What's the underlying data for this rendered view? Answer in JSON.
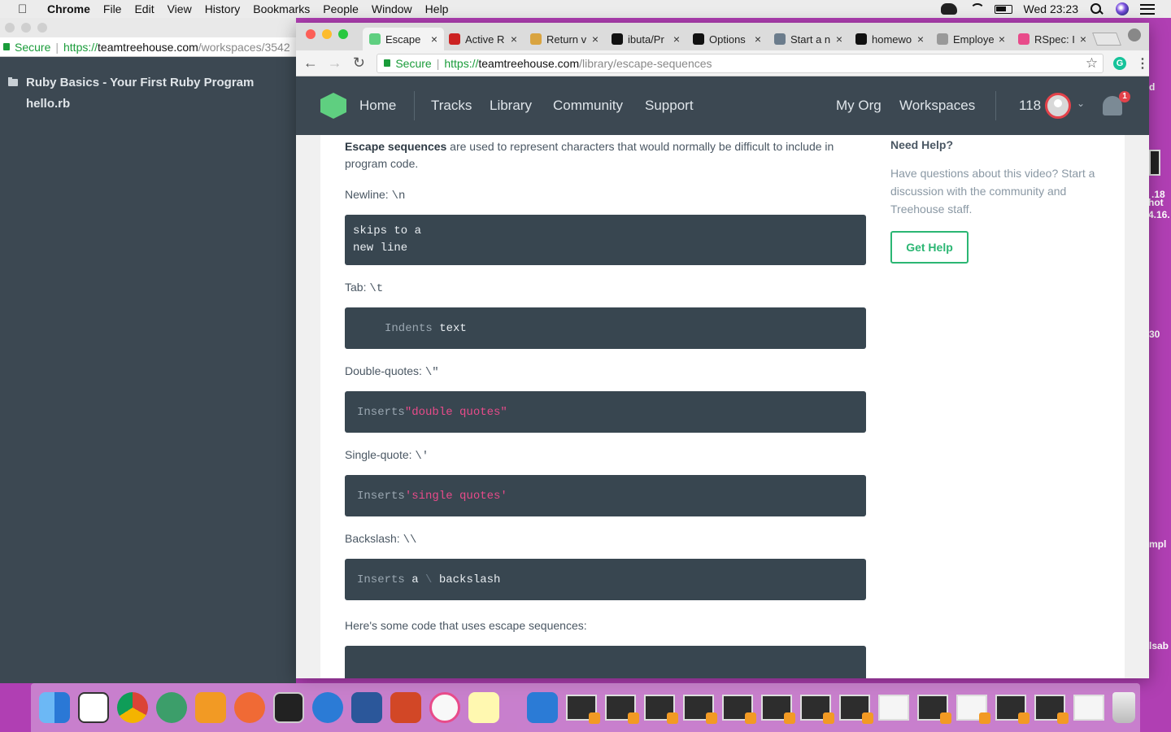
{
  "menubar": {
    "app": "Chrome",
    "items": [
      "File",
      "Edit",
      "View",
      "History",
      "Bookmarks",
      "People",
      "Window",
      "Help"
    ],
    "clock": "Wed 23:23"
  },
  "bg_window": {
    "secure": "Secure",
    "url_proto": "https://",
    "url_host": "teamtreehouse.com",
    "url_path": "/workspaces/3542",
    "folder": "Ruby Basics - Your First Ruby Program",
    "file": "hello.rb"
  },
  "desktop_fragments": [
    "d",
    ".18",
    "hot",
    "4.16.",
    "30",
    "mpl",
    "lsab"
  ],
  "tabs": [
    {
      "label": "Escape",
      "fav_color": "#5fcf80",
      "active": true
    },
    {
      "label": "Active R",
      "fav_color": "#cc2222"
    },
    {
      "label": "Return v",
      "fav_color": "#d9a440"
    },
    {
      "label": "ibuta/Pr",
      "fav_color": "#111111"
    },
    {
      "label": "Options",
      "fav_color": "#111111"
    },
    {
      "label": "Start a n",
      "fav_color": "#6b7c8c"
    },
    {
      "label": "homewo",
      "fav_color": "#111111"
    },
    {
      "label": "Employe",
      "fav_color": "#999999"
    },
    {
      "label": "RSpec: I",
      "fav_color": "#e84b8a"
    }
  ],
  "omnibox": {
    "secure": "Secure",
    "url_proto": "https://",
    "url_host": "teamtreehouse.com",
    "url_path": "/library/escape-sequences"
  },
  "site_nav": {
    "home": "Home",
    "tracks": "Tracks",
    "library": "Library",
    "community": "Community",
    "support": "Support",
    "my_org": "My Org",
    "workspaces": "Workspaces",
    "points": "118",
    "notifications": "1"
  },
  "article": {
    "intro_bold": "Escape sequences",
    "intro_rest": " are used to represent characters that would normally be difficult to include in program code.",
    "newline_label": "Newline: ",
    "newline_code": "\\n",
    "newline_block": [
      "skips to a",
      "new line"
    ],
    "tab_label": "Tab: ",
    "tab_code": "\\t",
    "tab_block_kw": "Indents",
    "tab_block_rest": " text",
    "dq_label": "Double-quotes: ",
    "dq_code": "\\\"",
    "dq_block_kw": "Inserts",
    "dq_block_str": "\"double quotes\"",
    "sq_label": "Single-quote: ",
    "sq_code": "\\'",
    "sq_block_kw": "Inserts",
    "sq_block_str": "'single quotes'",
    "bs_label": "Backslash: ",
    "bs_code": "\\\\",
    "bs_block_kw": "Inserts",
    "bs_block_a": " a ",
    "bs_block_slash": "\\",
    "bs_block_rest": " backslash",
    "outro": "Here's some code that uses escape sequences:"
  },
  "aside": {
    "title": "Need Help?",
    "text": "Have questions about this video? Start a discussion with the community and Treehouse staff.",
    "button": "Get Help"
  },
  "colors": {
    "accent": "#2bb673",
    "nav_bg": "#3c4852",
    "code_bg": "#384650",
    "string": "#e84b8a"
  },
  "dock": {
    "apps": [
      "finder",
      "slack",
      "chrome",
      "atom",
      "sublime",
      "postman",
      "terminal",
      "markdown",
      "word",
      "powerpoint",
      "itunes",
      "notes",
      "macdown"
    ]
  }
}
